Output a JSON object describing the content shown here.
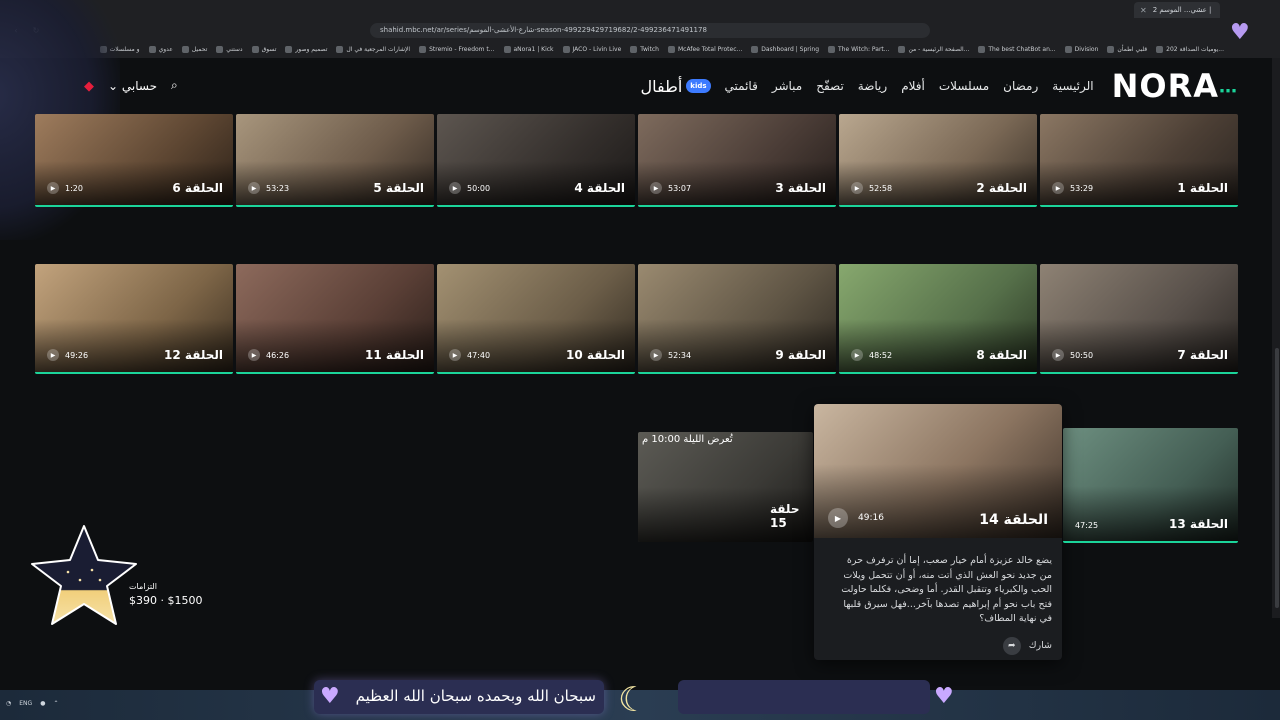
{
  "browser": {
    "tab_title": "عشي... الموسم 2 |",
    "url": "shahid.mbc.net/ar/series/شارع-الأعشى-الموسم-season-499229429719682/2-499236471491178",
    "bookmarks": [
      "و مسلسلات",
      "عدوي",
      "تحميل",
      "دستني",
      "تسوق",
      "تصميم وصور",
      "الإشارات المرجعية في ال",
      "Stremio - Freedom t...",
      "aNora1 | Kick",
      "JACO - Livin Live",
      "Twitch",
      "McAfee Total Protec...",
      "Dashboard | Spring",
      "The Witch: Part...",
      "الصفحة الرئيسية - من...",
      "The best ChatBot an...",
      "Division",
      "قلبي اطمأن",
      "يوميات الصداقة 202..."
    ]
  },
  "header": {
    "logo": "NORA",
    "nav": [
      "الرئيسية",
      "رمضان",
      "مسلسلات",
      "أفلام",
      "رياضة",
      "تصفّح",
      "مباشر",
      "قائمتي"
    ],
    "kids_label": "أطفال",
    "kids_badge": "kids",
    "account_label": "حسابي"
  },
  "episodes_row1": [
    {
      "title": "الحلقة 1",
      "duration": "53:29"
    },
    {
      "title": "الحلقة 2",
      "duration": "52:58"
    },
    {
      "title": "الحلقة 3",
      "duration": "53:07"
    },
    {
      "title": "الحلقة 4",
      "duration": "50:00"
    },
    {
      "title": "الحلقة 5",
      "duration": "53:23"
    },
    {
      "title": "الحلقة 6",
      "duration": "1:20"
    }
  ],
  "episodes_row2": [
    {
      "title": "الحلقة 7",
      "duration": "50:50"
    },
    {
      "title": "الحلقة 8",
      "duration": "48:52"
    },
    {
      "title": "الحلقة 9",
      "duration": "52:34"
    },
    {
      "title": "الحلقة 10",
      "duration": "47:40"
    },
    {
      "title": "الحلقة 11",
      "duration": "46:26"
    },
    {
      "title": "الحلقة 12",
      "duration": "49:26"
    }
  ],
  "episode13": {
    "title": "الحلقة 13",
    "duration": "47:25"
  },
  "episode15": {
    "title": "حلقة 15",
    "airs": "تُعرض الليلة 10:00 م"
  },
  "hover_card": {
    "title": "الحلقة 14",
    "duration": "49:16",
    "description": "يضع خالد عزيزة أمام خيار صعب، إما أن ترفرف حرة من جديد نحو العش الذي أتت منه، أو أن تتحمل ويلات الحب والكبرياء وتتقبل القدر. أما وضحى، فكلما حاولت فتح باب نحو أم إبراهيم تصدها بآخر...فهل سيرق قلبها في نهاية المطاف؟",
    "share_label": "شارك"
  },
  "pledge": {
    "label": "التزامات",
    "amount": "$390 · $1500"
  },
  "banner_text": "سبحان الله وبحمده سبحان الله العظيم",
  "taskbar": {
    "lang": "ENG"
  },
  "colors": {
    "accent": "#1bd49a",
    "page_bg": "#0d0f11",
    "card_bg": "#1b1d20"
  }
}
